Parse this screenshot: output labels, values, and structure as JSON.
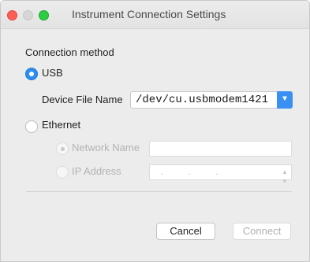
{
  "window": {
    "title": "Instrument Connection Settings"
  },
  "connection": {
    "section_label": "Connection method",
    "usb_label": "USB",
    "usb_selected": true,
    "device_file_label": "Device File Name",
    "device_file_value": "/dev/cu.usbmodem1421",
    "ethernet_label": "Ethernet",
    "ethernet_selected": false,
    "network_name_label": "Network Name",
    "network_name_value": "",
    "ip_address_label": "IP Address",
    "ip_address_placeholder": ". . ."
  },
  "buttons": {
    "cancel_label": "Cancel",
    "connect_label": "Connect"
  },
  "colors": {
    "accent": "#2d8ef0",
    "close": "#fd5f57",
    "zoom": "#2ecc40"
  }
}
